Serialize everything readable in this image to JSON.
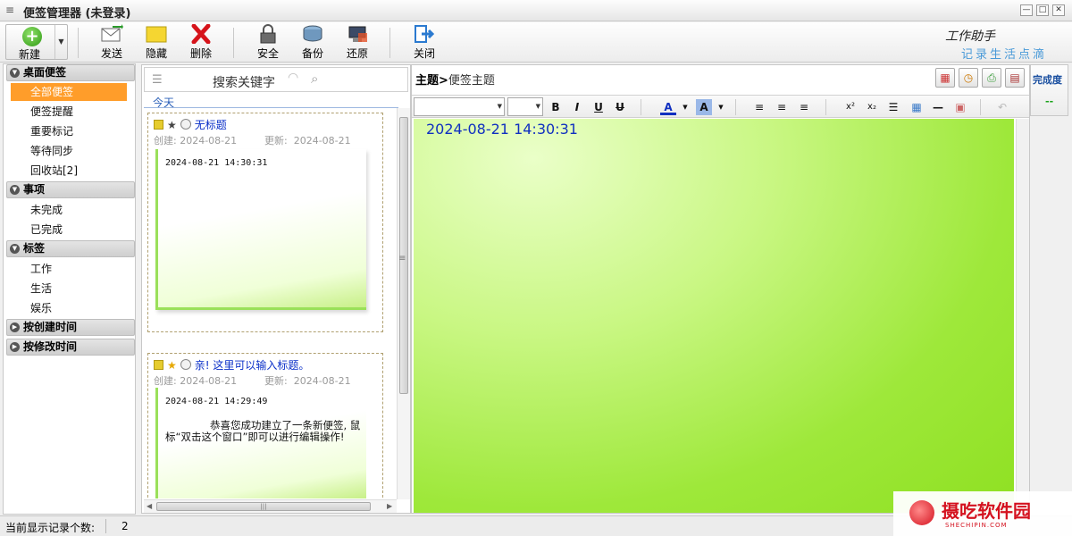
{
  "window": {
    "title": "便签管理器 (未登录)"
  },
  "toolbar": {
    "new_label": "新建",
    "send_label": "发送",
    "hide_label": "隐藏",
    "delete_label": "删除",
    "security_label": "安全",
    "backup_label": "备份",
    "restore_label": "还原",
    "close_label": "关闭",
    "brand_line1": "工作助手",
    "brand_line2": "记录生活点滴"
  },
  "sidebar": {
    "groups": [
      {
        "label": "桌面便签",
        "items": [
          "全部便签",
          "便签提醒",
          "重要标记",
          "等待同步",
          "回收站[2]"
        ]
      },
      {
        "label": "事项",
        "items": [
          "未完成",
          "已完成"
        ]
      },
      {
        "label": "标签",
        "items": [
          "工作",
          "生活",
          "娱乐"
        ]
      },
      {
        "label": "按创建时间",
        "items": []
      },
      {
        "label": "按修改时间",
        "items": []
      }
    ],
    "active_item": "全部便签"
  },
  "list": {
    "search_placeholder": "搜索关键字",
    "date_group": "今天",
    "notes": [
      {
        "title": "无标题",
        "created_label": "创建:",
        "created": "2024-08-21",
        "updated_label": "更新:",
        "updated": "2024-08-21",
        "timestamp": "2024-08-21 14:30:31",
        "body": ""
      },
      {
        "title": "亲! 这里可以输入标题。",
        "created_label": "创建:",
        "created": "2024-08-21",
        "updated_label": "更新:",
        "updated": "2024-08-21",
        "timestamp": "2024-08-21 14:29:49",
        "body": "恭喜您成功建立了一条新便签, 鼠标“双击这个窗口”即可以进行编辑操作!"
      }
    ]
  },
  "editor": {
    "subject_label": "主题",
    "subject_arrow": ">",
    "subject_value": "便签主题",
    "content_timestamp": "2024-08-21 14:30:31",
    "bg_color": "#9ee83a"
  },
  "completion": {
    "label": "完成度",
    "value": "--"
  },
  "status": {
    "count_label": "当前显示记录个数:",
    "count_value": "2"
  },
  "watermark": {
    "text": "摄吃软件园",
    "sub": "SHECHIPIN.COM"
  },
  "colors": {
    "accent_orange": "#ff9d2a",
    "link_blue": "#0a2fc8",
    "note_green": "#8fe022"
  }
}
